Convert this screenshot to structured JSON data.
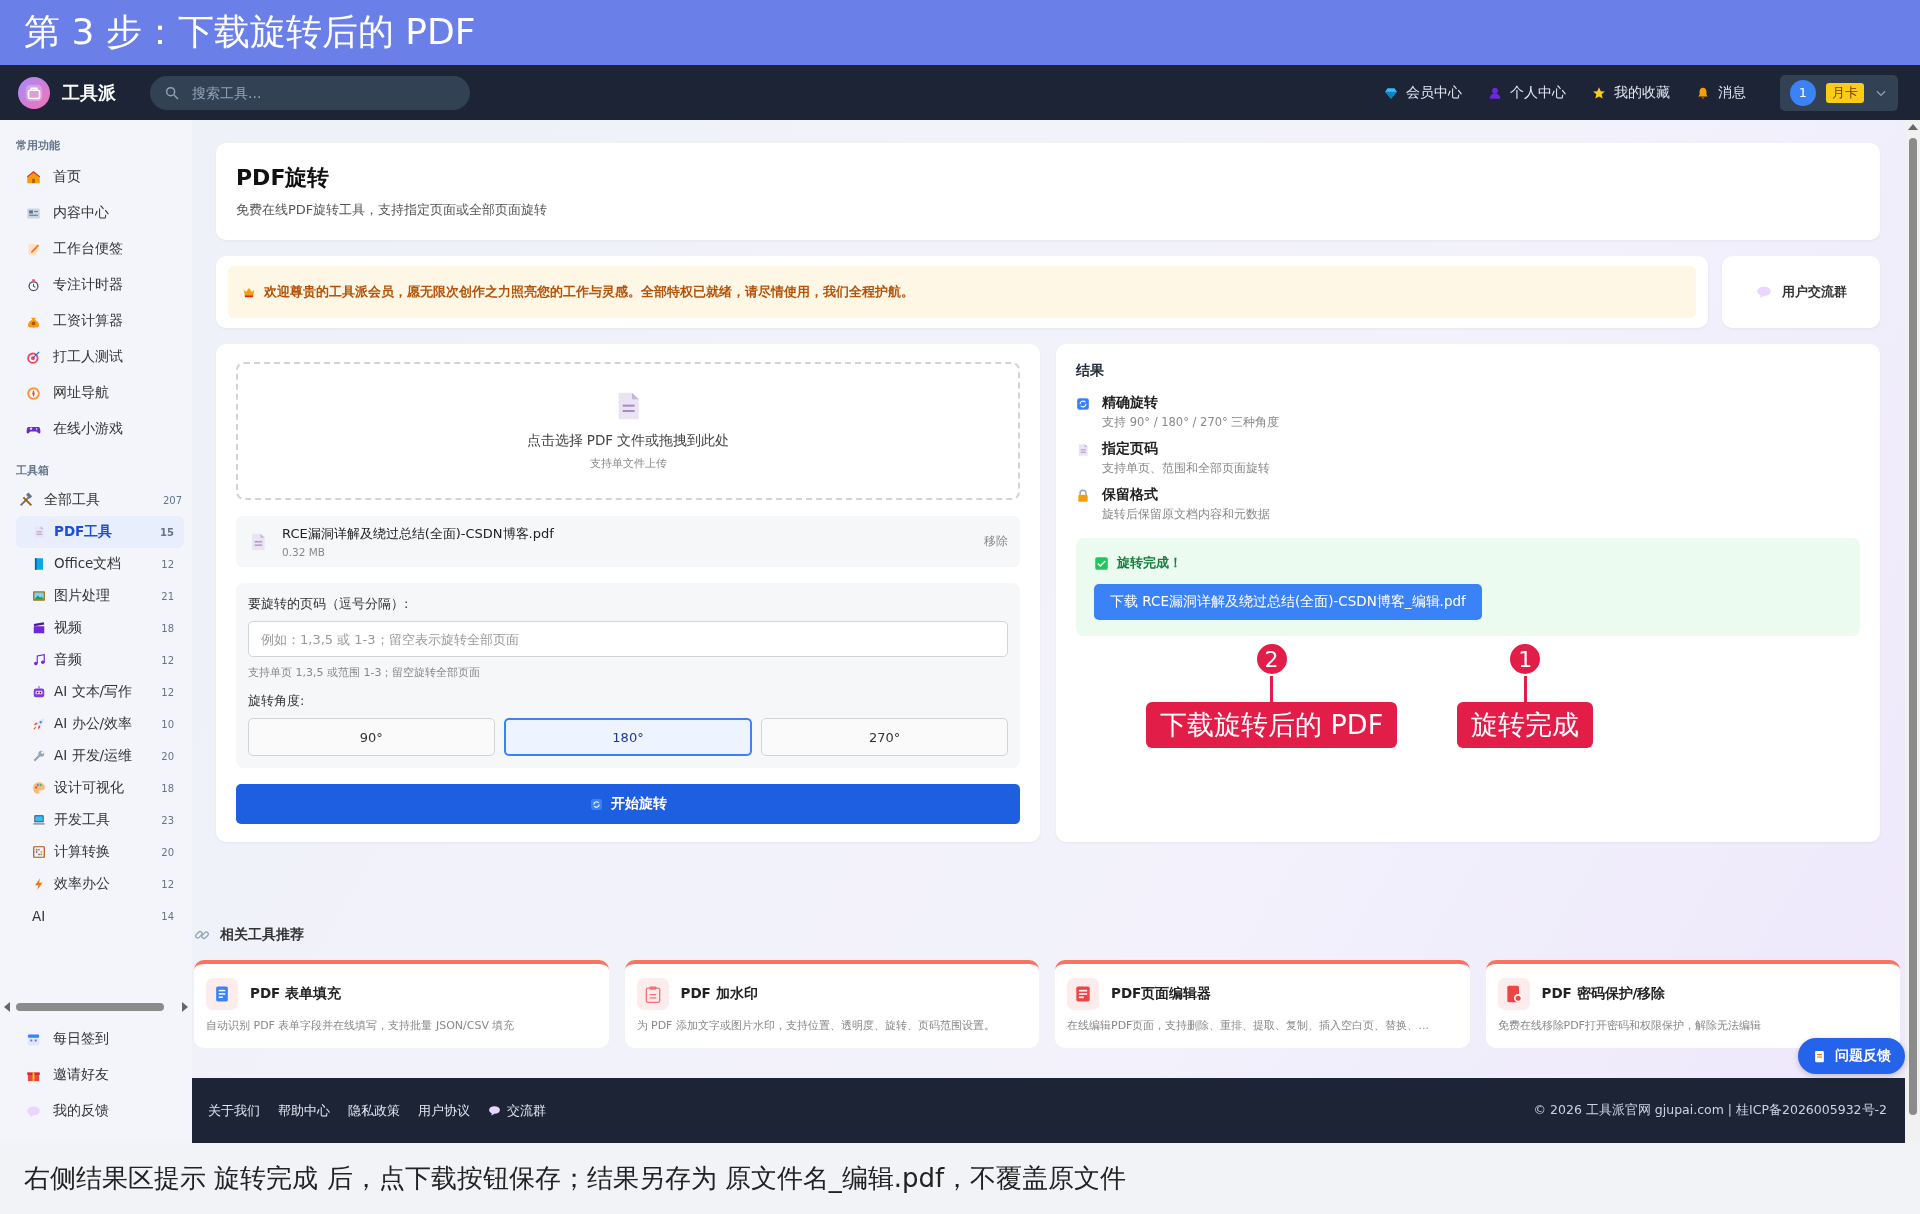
{
  "tutorial": {
    "title": "第 3 步：下载旋转后的 PDF",
    "caption": "右侧结果区提示 旋转完成 后，点下载按钮保存；结果另存为 原文件名_编辑.pdf，不覆盖原文件"
  },
  "header": {
    "brand": "工具派",
    "search": {
      "placeholder": "搜索工具..."
    },
    "nav": [
      "会员中心",
      "个人中心",
      "我的收藏",
      "消息"
    ],
    "user": {
      "avatar": "1",
      "badge": "月卡"
    }
  },
  "sidebar": {
    "sections": [
      {
        "title": "常用功能",
        "items": [
          {
            "label": "首页"
          },
          {
            "label": "内容中心"
          },
          {
            "label": "工作台便签"
          },
          {
            "label": "专注计时器"
          },
          {
            "label": "工资计算器"
          },
          {
            "label": "打工人测试"
          },
          {
            "label": "网址导航"
          },
          {
            "label": "在线小游戏"
          }
        ]
      },
      {
        "title": "工具箱",
        "items": [
          {
            "label": "全部工具",
            "count": "207",
            "children": [
              {
                "label": "PDF工具",
                "count": "15",
                "selected": true
              },
              {
                "label": "Office文档",
                "count": "12",
                "selected": false
              },
              {
                "label": "图片处理",
                "count": "21",
                "selected": false
              },
              {
                "label": "视频",
                "count": "18",
                "selected": false
              },
              {
                "label": "音频",
                "count": "12",
                "selected": false
              },
              {
                "label": "AI 文本/写作",
                "count": "12",
                "selected": false
              },
              {
                "label": "AI 办公/效率",
                "count": "10",
                "selected": false
              },
              {
                "label": "AI 开发/运维",
                "count": "20",
                "selected": false
              },
              {
                "label": "设计可视化",
                "count": "18",
                "selected": false
              },
              {
                "label": "开发工具",
                "count": "23",
                "selected": false
              },
              {
                "label": "计算转换",
                "count": "20",
                "selected": false
              },
              {
                "label": "效率办公",
                "count": "12",
                "selected": false
              },
              {
                "label": "AI",
                "count": "14",
                "selected": false
              }
            ]
          }
        ]
      }
    ],
    "bottom": [
      "每日签到",
      "邀请好友",
      "我的反馈"
    ]
  },
  "page": {
    "title": "PDF旋转",
    "subtitle": "免费在线PDF旋转工具，支持指定页面或全部页面旋转"
  },
  "notice": {
    "text": "欢迎尊贵的工具派会员，愿无限次创作之力照亮您的工作与灵感。全部特权已就绪，请尽情使用，我们全程护航。",
    "group_button": "用户交流群"
  },
  "upload": {
    "prompt": "点击选择 PDF 文件或拖拽到此处",
    "hint": "支持单文件上传"
  },
  "file": {
    "name": "RCE漏洞详解及绕过总结(全面)-CSDN博客.pdf",
    "size": "0.32 MB",
    "remove": "移除"
  },
  "pages": {
    "label": "要旋转的页码（逗号分隔）:",
    "placeholder": "例如：1,3,5 或 1-3；留空表示旋转全部页面",
    "hint": "支持单页 1,3,5 或范围 1-3；留空旋转全部页面"
  },
  "angle": {
    "label": "旋转角度:",
    "options": [
      {
        "label": "90°",
        "selected": false
      },
      {
        "label": "180°",
        "selected": true
      },
      {
        "label": "270°",
        "selected": false
      }
    ]
  },
  "start_button": "开始旋转",
  "result": {
    "title": "结果",
    "features": [
      {
        "title": "精确旋转",
        "desc": "支持 90° / 180° / 270° 三种角度"
      },
      {
        "title": "指定页码",
        "desc": "支持单页、范围和全部页面旋转"
      },
      {
        "title": "保留格式",
        "desc": "旋转后保留原文档内容和元数据"
      }
    ],
    "status": "旋转完成！",
    "download": "下载 RCE漏洞详解及绕过总结(全面)-CSDN博客_编辑.pdf"
  },
  "annotations": [
    {
      "marker": "2",
      "text": "下载旋转后的 PDF"
    },
    {
      "marker": "1",
      "text": "旋转完成"
    }
  ],
  "related": {
    "title": "相关工具推荐",
    "cards": [
      {
        "title": "PDF 表单填充",
        "desc": "自动识别 PDF 表单字段并在线填写，支持批量 JSON/CSV 填充"
      },
      {
        "title": "PDF 加水印",
        "desc": "为 PDF 添加文字或图片水印，支持位置、透明度、旋转、页码范围设置。"
      },
      {
        "title": "PDF页面编辑器",
        "desc": "在线编辑PDF页面，支持删除、重排、提取、复制、插入空白页、替换、..."
      },
      {
        "title": "PDF 密码保护/移除",
        "desc": "免费在线移除PDF打开密码和权限保护，解除无法编辑"
      }
    ]
  },
  "feedback_button": "问题反馈",
  "footer": {
    "links": [
      "关于我们",
      "帮助中心",
      "隐私政策",
      "用户协议",
      "交流群"
    ],
    "copyright": "© 2026 工具派官网 gjupai.com | 桂ICP备2026005932号-2"
  }
}
